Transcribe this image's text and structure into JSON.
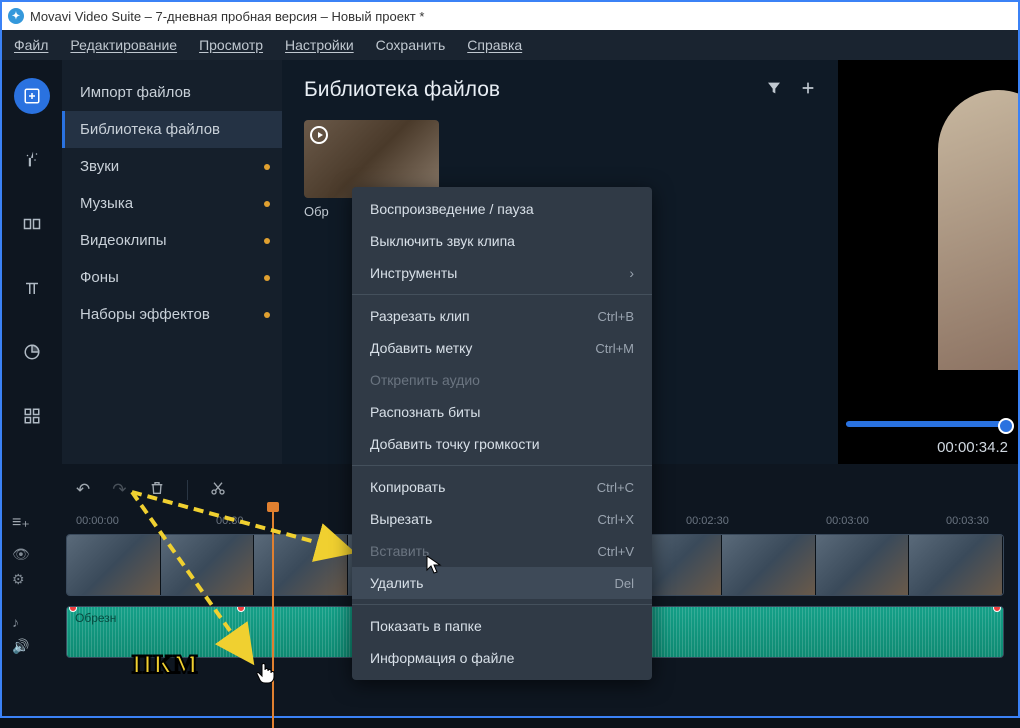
{
  "titlebar": {
    "text": "Movavi Video Suite – 7-дневная пробная версия – Новый проект *"
  },
  "menubar": {
    "file": "Файл",
    "edit": "Редактирование",
    "view": "Просмотр",
    "settings": "Настройки",
    "save": "Сохранить",
    "help": "Справка"
  },
  "sidepanel": {
    "import": "Импорт файлов",
    "library": "Библиотека файлов",
    "sounds": "Звуки",
    "music": "Музыка",
    "videoclips": "Видеоклипы",
    "backgrounds": "Фоны",
    "effects": "Наборы эффектов"
  },
  "library": {
    "title": "Библиотека файлов",
    "thumb_label": "Обр"
  },
  "preview": {
    "time": "00:00:34.2"
  },
  "ruler": {
    "t0": "00:00:00",
    "t1": "00:30",
    "t6": "00:02:30",
    "t7": "00:03:00",
    "t8": "00:03:30"
  },
  "audio_track": {
    "label": "Обрезн"
  },
  "context_menu": {
    "play_pause": "Воспроизведение / пауза",
    "mute_clip": "Выключить звук клипа",
    "tools": "Инструменты",
    "split": "Разрезать клип",
    "split_key": "Ctrl+B",
    "marker": "Добавить метку",
    "marker_key": "Ctrl+M",
    "detach_audio": "Открепить аудио",
    "beats": "Распознать биты",
    "volume_point": "Добавить точку громкости",
    "copy": "Копировать",
    "copy_key": "Ctrl+C",
    "cut": "Вырезать",
    "cut_key": "Ctrl+X",
    "paste": "Вставить",
    "paste_key": "Ctrl+V",
    "delete": "Удалить",
    "delete_key": "Del",
    "show_folder": "Показать в папке",
    "file_info": "Информация о файле"
  },
  "annotation": {
    "pkm": "ПКМ"
  }
}
